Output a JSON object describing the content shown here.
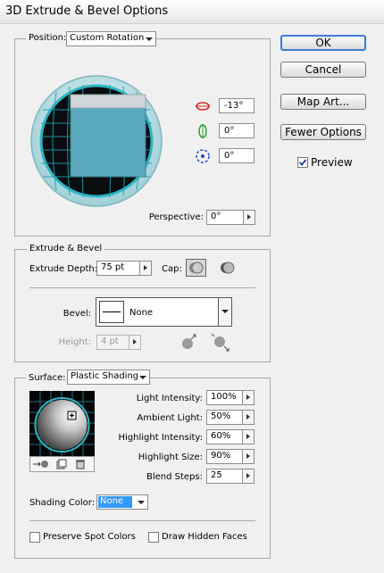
{
  "window": {
    "title": "3D Extrude & Bevel Options"
  },
  "buttons": {
    "ok": "OK",
    "cancel": "Cancel",
    "map_art": "Map Art...",
    "fewer_options": "Fewer Options",
    "preview_label": "Preview",
    "preview_checked": true
  },
  "position": {
    "label": "Position:",
    "preset": "Custom Rotation",
    "x_rotation": "-13°",
    "y_rotation": "0°",
    "z_rotation": "0°",
    "perspective_label": "Perspective:",
    "perspective": "0°"
  },
  "extrude": {
    "section_label": "Extrude & Bevel",
    "depth_label": "Extrude Depth:",
    "depth": "75 pt",
    "cap_label": "Cap:",
    "bevel_label": "Bevel:",
    "bevel": "None",
    "height_label": "Height:",
    "height": "4 pt"
  },
  "surface": {
    "label": "Surface:",
    "type": "Plastic Shading",
    "light_intensity_label": "Light Intensity:",
    "light_intensity": "100%",
    "ambient_light_label": "Ambient Light:",
    "ambient_light": "50%",
    "highlight_intensity_label": "Highlight Intensity:",
    "highlight_intensity": "60%",
    "highlight_size_label": "Highlight Size:",
    "highlight_size": "90%",
    "blend_steps_label": "Blend Steps:",
    "blend_steps": "25",
    "shading_color_label": "Shading Color:",
    "shading_color": "None",
    "preserve_spot_label": "Preserve Spot Colors",
    "draw_hidden_label": "Draw Hidden Faces"
  },
  "colors": {
    "accent": "#3d7bd3",
    "globe_teal": "#2fb6c4",
    "selection_blue": "#3399ff"
  }
}
